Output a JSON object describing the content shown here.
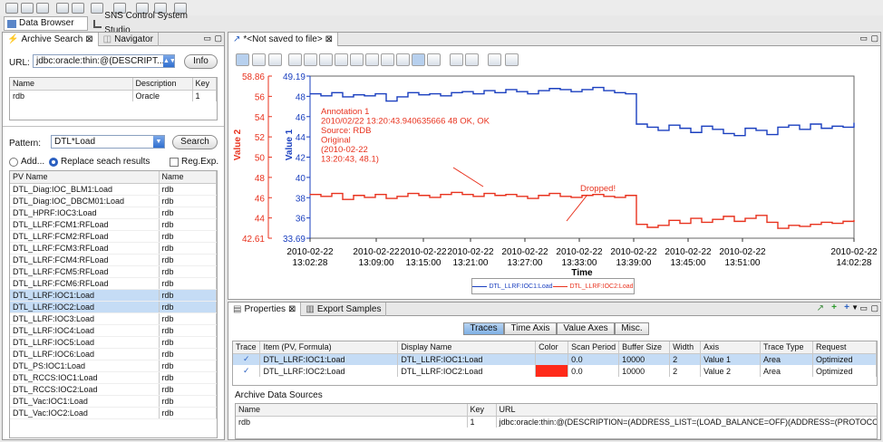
{
  "persp_tabs": [
    "Data Browser",
    "SNS Control System Studio"
  ],
  "left_tabs": [
    "Archive Search",
    "Navigator"
  ],
  "url": {
    "label": "URL:",
    "value": "jdbc:oracle:thin:@(DESCRIPT...",
    "info_btn": "Info"
  },
  "archives": {
    "headers": [
      "Name",
      "Description",
      "Key"
    ],
    "rows": [
      [
        "rdb",
        "Oracle",
        "1"
      ]
    ]
  },
  "pattern": {
    "label": "Pattern:",
    "value": "DTL*Load",
    "search_btn": "Search",
    "add": "Add...",
    "replace": "Replace seach results",
    "regexp": "Reg.Exp."
  },
  "pv_list": {
    "headers": [
      "PV Name",
      "Name"
    ],
    "rows": [
      [
        "DTL_Diag:IOC_BLM1:Load",
        "rdb"
      ],
      [
        "DTL_Diag:IOC_DBCM01:Load",
        "rdb"
      ],
      [
        "DTL_HPRF:IOC3:Load",
        "rdb"
      ],
      [
        "DTL_LLRF:FCM1:RFLoad",
        "rdb"
      ],
      [
        "DTL_LLRF:FCM2:RFLoad",
        "rdb"
      ],
      [
        "DTL_LLRF:FCM3:RFLoad",
        "rdb"
      ],
      [
        "DTL_LLRF:FCM4:RFLoad",
        "rdb"
      ],
      [
        "DTL_LLRF:FCM5:RFLoad",
        "rdb"
      ],
      [
        "DTL_LLRF:FCM6:RFLoad",
        "rdb"
      ],
      [
        "DTL_LLRF:IOC1:Load",
        "rdb"
      ],
      [
        "DTL_LLRF:IOC2:Load",
        "rdb"
      ],
      [
        "DTL_LLRF:IOC3:Load",
        "rdb"
      ],
      [
        "DTL_LLRF:IOC4:Load",
        "rdb"
      ],
      [
        "DTL_LLRF:IOC5:Load",
        "rdb"
      ],
      [
        "DTL_LLRF:IOC6:Load",
        "rdb"
      ],
      [
        "DTL_PS:IOC1:Load",
        "rdb"
      ],
      [
        "DTL_RCCS:IOC1:Load",
        "rdb"
      ],
      [
        "DTL_RCCS:IOC2:Load",
        "rdb"
      ],
      [
        "DTL_Vac:IOC1:Load",
        "rdb"
      ],
      [
        "DTL_Vac:IOC2:Load",
        "rdb"
      ]
    ],
    "selected": [
      9,
      10
    ]
  },
  "editor_tab": "*<Not saved to file>",
  "chart_data": {
    "type": "line",
    "y1": {
      "label": "Value 1",
      "ticks": [
        "49.19",
        "48",
        "46",
        "44",
        "42",
        "40",
        "38",
        "36",
        "33.69"
      ],
      "color": "#1a3fbf"
    },
    "y2": {
      "label": "Value 2",
      "ticks": [
        "58.86",
        "56",
        "54",
        "52",
        "50",
        "48",
        "46",
        "44",
        "42.61"
      ],
      "color": "#e8321e"
    },
    "x_ticks": [
      [
        "2010-02-22",
        "13:02:28"
      ],
      [
        "2010-02-22",
        "13:09:00"
      ],
      [
        "2010-02-22",
        "13:15:00"
      ],
      [
        "2010-02-22",
        "13:21:00"
      ],
      [
        "2010-02-22",
        "13:27:00"
      ],
      [
        "2010-02-22",
        "13:33:00"
      ],
      [
        "2010-02-22",
        "13:39:00"
      ],
      [
        "2010-02-22",
        "13:45:00"
      ],
      [
        "2010-02-22",
        "13:51:00"
      ],
      [
        "2010-02-22",
        "14:02:28"
      ]
    ],
    "xlabel": "Time",
    "annotation": [
      "Annotation 1",
      "2010/02/22 13:20:43.940635666   48    OK, OK",
      "Source: RDB",
      "Original",
      "(2010-02-22",
      "13:20:43, 48.1)"
    ],
    "dropped": "Dropped!",
    "legend": [
      "DTL_LLRF:IOC1:Load",
      "DTL_LLRF:IOC2:Load"
    ],
    "series": [
      {
        "name": "DTL_LLRF:IOC1:Load",
        "color": "#1a3fbf",
        "values": [
          47.5,
          47.3,
          47.6,
          47.2,
          47.4,
          47.3,
          47.5,
          46.8,
          47.2,
          47.6,
          47.4,
          47.5,
          47.3,
          47.6,
          47.7,
          47.5,
          47.8,
          47.6,
          47.9,
          47.7,
          47.5,
          47.8,
          48.0,
          47.9,
          47.7,
          47.9,
          48.1,
          47.8,
          47.6,
          47.5,
          44.6,
          44.3,
          44.0,
          44.5,
          44.2,
          43.8,
          44.4,
          44.1,
          43.7,
          43.5,
          44.2,
          44.0,
          43.6,
          44.3,
          44.5,
          44.1,
          44.6,
          44.2,
          44.4,
          44.3,
          44.7
        ]
      },
      {
        "name": "DTL_LLRF:IOC2:Load",
        "color": "#e8321e",
        "values": [
          47.0,
          46.8,
          47.1,
          46.5,
          46.9,
          46.7,
          47.0,
          46.6,
          46.8,
          47.1,
          46.9,
          46.7,
          47.0,
          47.2,
          47.0,
          46.8,
          47.1,
          46.9,
          47.0,
          46.8,
          46.6,
          46.9,
          47.1,
          46.8,
          46.7,
          46.9,
          47.0,
          46.8,
          46.7,
          46.9,
          44.0,
          43.7,
          43.9,
          44.4,
          44.1,
          44.6,
          44.2,
          44.5,
          44.8,
          44.3,
          44.6,
          44.9,
          44.2,
          43.6,
          43.9,
          43.8,
          44.0,
          44.2,
          44.1,
          44.3,
          44.4
        ]
      }
    ]
  },
  "bottom_tabs": [
    "Properties",
    "Export Samples"
  ],
  "seg_tabs": [
    "Traces",
    "Time Axis",
    "Value Axes",
    "Misc."
  ],
  "traces": {
    "headers": [
      "Trace",
      "Item (PV, Formula)",
      "Display Name",
      "Color",
      "Scan Period",
      "Buffer Size",
      "Width",
      "Axis",
      "Trace Type",
      "Request"
    ],
    "rows": [
      [
        "✓",
        "DTL_LLRF:IOC1:Load",
        "DTL_LLRF:IOC1:Load",
        "",
        "0.0",
        "10000",
        "2",
        "Value 1",
        "Area",
        "Optimized"
      ],
      [
        "✓",
        "DTL_LLRF:IOC2:Load",
        "DTL_LLRF:IOC2:Load",
        "#ff2a1a",
        "0.0",
        "10000",
        "2",
        "Value 2",
        "Area",
        "Optimized"
      ]
    ]
  },
  "sources": {
    "title": "Archive Data Sources",
    "headers": [
      "Name",
      "Key",
      "URL"
    ],
    "rows": [
      [
        "rdb",
        "1",
        "jdbc:oracle:thin:@(DESCRIPTION=(ADDRESS_LIST=(LOAD_BALANCE=OFF)(ADDRESS=(PROTOCOL=TCP)(HOST="
      ]
    ]
  }
}
